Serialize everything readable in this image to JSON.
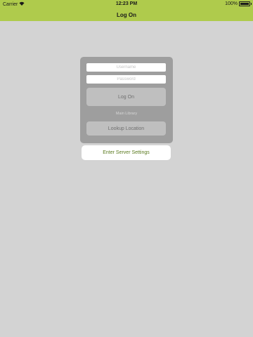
{
  "status_bar": {
    "carrier": "Carrier",
    "time": "12:23 PM",
    "battery_percent": "100%"
  },
  "nav": {
    "title": "Log On"
  },
  "login_form": {
    "username_placeholder": "Username",
    "password_placeholder": "Password",
    "logon_label": "Log On",
    "library_label": "Main Library",
    "lookup_label": "Lookup Location"
  },
  "server_settings": {
    "label": "Enter Server Settings"
  },
  "colors": {
    "accent": "#afcb4c",
    "background": "#d3d3d3",
    "panel": "#9e9e9e",
    "link_text": "#5a7a1e"
  },
  "icons": {
    "wifi": "wifi-icon",
    "battery": "battery-icon"
  }
}
